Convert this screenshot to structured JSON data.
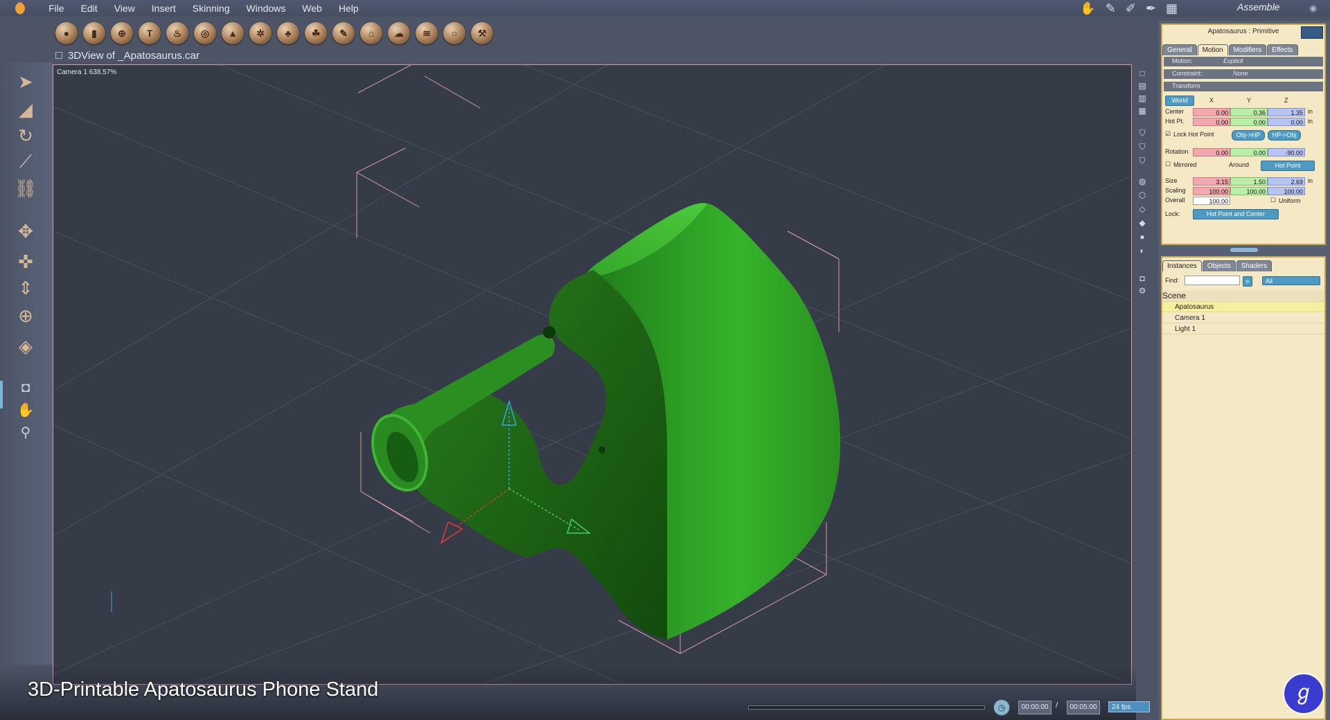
{
  "menubar": {
    "items": [
      "File",
      "Edit",
      "View",
      "Insert",
      "Skinning",
      "Windows",
      "Web",
      "Help"
    ],
    "room": "Assemble"
  },
  "toolbar": {
    "primitive_icons": [
      "sphere-icon",
      "cylinder-icon",
      "globe-icon",
      "text-icon",
      "flame-icon",
      "torus-icon",
      "terrain-icon",
      "gear-icon",
      "tree-icon",
      "plant-icon",
      "pencil-icon",
      "building-icon",
      "cloud-icon",
      "ground-icon",
      "ring-icon",
      "wrench-icon"
    ]
  },
  "view": {
    "title": "3DView of _Apatosaurus.car",
    "camera_label": "Camera 1 638.57%"
  },
  "caption": "3D-Printable Apatosaurus Phone Stand",
  "timeline": {
    "current_time": "00:00:00",
    "separator": "/",
    "end_time": "00:05:00",
    "fps": "24 fps"
  },
  "properties": {
    "title": "Apatosaurus : Primitive",
    "tabs": [
      "General",
      "Motion",
      "Modifiers",
      "Effects"
    ],
    "active_tab": "Motion",
    "motion_label": "Motion:",
    "motion_value": "Explicit",
    "constraint_label": "Constraint:",
    "constraint_value": "None",
    "transform_label": "Transform",
    "space": "World",
    "col_x": "X",
    "col_y": "Y",
    "col_z": "Z",
    "unit": "in",
    "center_label": "Center",
    "center": [
      "0.00",
      "0.36",
      "1.35"
    ],
    "hotpt_label": "Hot Pt.",
    "hotpt": [
      "0.00",
      "0.00",
      "0.00"
    ],
    "lock_hot_point_label": "Lock Hot Point",
    "obj_to_hp": "Obj->HP",
    "hp_to_obj": "HP->Obj",
    "rotation_label": "Rotation",
    "rotation": [
      "0.00",
      "0.00",
      "-90.00"
    ],
    "mirrored_label": "Mirrored",
    "around_label": "Around",
    "around_value": "Hot Point",
    "size_label": "Size",
    "size": [
      "3.15",
      "1.50",
      "2.69"
    ],
    "scaling_label": "Scaling",
    "scaling": [
      "100.00",
      "100.00",
      "100.00"
    ],
    "overall_label": "Overall",
    "overall": "100.00",
    "uniform_label": "Uniform",
    "lock_label": "Lock:",
    "lock_value": "Hot Point and Center"
  },
  "scene_panel": {
    "tabs": [
      "Instances",
      "Objects",
      "Shaders"
    ],
    "active_tab": "Instances",
    "find_label": "Find:",
    "filter_value": "All",
    "header": "Scene",
    "items": [
      "Apatosaurus",
      "Camera 1",
      "Light 1"
    ],
    "selected": "Apatosaurus"
  },
  "colors": {
    "model_green": "#2f9a24",
    "selection_pink": "#d89aa3",
    "panel_bg": "#f5e8c5",
    "accent_blue": "#4d9ac3"
  }
}
